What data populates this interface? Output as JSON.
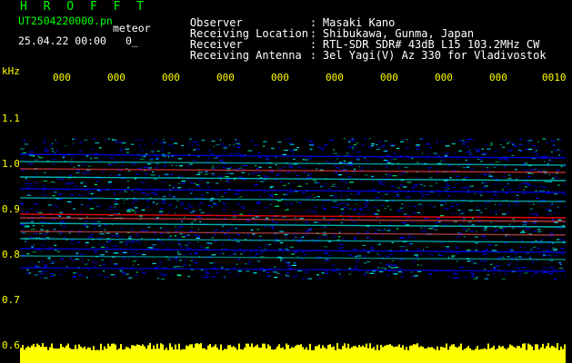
{
  "header": {
    "brand": "H R O F F T",
    "filename": "UT2504220000.pn",
    "mode": "meteor",
    "date": "25.04.22 00:00",
    "date_extra": "0_",
    "info": [
      {
        "label": "Observer",
        "value": "Masaki Kano"
      },
      {
        "label": "Receiving Location",
        "value": "Shibukawa, Gunma, Japan"
      },
      {
        "label": "Receiver",
        "value": "RTL-SDR SDR# 43dB L15 103.2MHz CW"
      },
      {
        "label": "Receiving Antenna",
        "value": "3el Yagi(V) Az 330 for Vladivostok"
      }
    ]
  },
  "chart_data": {
    "type": "heatmap",
    "ylabel": "kHz",
    "y_ticks": [
      "1.1",
      "1.0",
      "0.9",
      "0.8",
      "0.7",
      "0.6"
    ],
    "x_ticks": [
      "000",
      "000",
      "000",
      "000",
      "000",
      "000",
      "000",
      "000",
      "000",
      "0010"
    ],
    "ylim": [
      0.6,
      1.15
    ],
    "colors": {
      "background": "#000000",
      "axis_text": "#ffff00",
      "low": "#0000ff",
      "mid": "#00ffff",
      "high": "#ff0000",
      "power_bar": "#ffff00"
    }
  }
}
